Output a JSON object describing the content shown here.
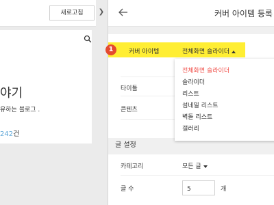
{
  "left": {
    "refresh_label": "새로고침",
    "blog_title": "야기",
    "blog_desc": "유하는 블로그 .",
    "post_count_num": "242",
    "post_count_unit": "건"
  },
  "header": {
    "title": "커버 아이템 등록"
  },
  "cover": {
    "badge": "1",
    "label": "커버 아이템",
    "selected": "전체화면 슬라이더",
    "options": [
      "전체화면 슬라이더",
      "슬라이더",
      "리스트",
      "섬네일 리스트",
      "벽돌 리스트",
      "갤러리"
    ]
  },
  "fields": {
    "title_label": "타이틀",
    "content_label": "콘텐츠"
  },
  "settings": {
    "section_title": "글 설정",
    "category_label": "카테고리",
    "category_value": "모든 글",
    "count_label": "글 수",
    "count_value": "5",
    "count_unit": "개"
  }
}
